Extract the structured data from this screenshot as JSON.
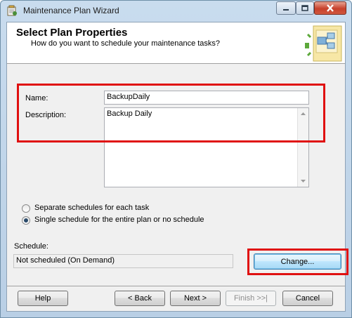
{
  "window": {
    "title": "Maintenance Plan Wizard",
    "controls": [
      "minimize-icon",
      "maximize-icon",
      "close-icon"
    ]
  },
  "header": {
    "title": "Select Plan Properties",
    "subtitle": "How do you want to schedule your maintenance tasks?"
  },
  "form": {
    "name_label": "Name:",
    "name_value": "BackupDaily",
    "description_label": "Description:",
    "description_value": "Backup Daily"
  },
  "schedule_options": [
    {
      "label": "Separate schedules for each task",
      "checked": false
    },
    {
      "label": "Single schedule for the entire plan or no schedule",
      "checked": true
    }
  ],
  "schedule": {
    "label": "Schedule:",
    "value": "Not scheduled (On Demand)",
    "change_label": "Change..."
  },
  "footer": {
    "help_label": "Help",
    "back_label": "< Back",
    "next_label": "Next >",
    "finish_label": "Finish >>|",
    "cancel_label": "Cancel"
  },
  "colors": {
    "highlight_box": "#e01010",
    "title_bar": "#c9dcee"
  }
}
